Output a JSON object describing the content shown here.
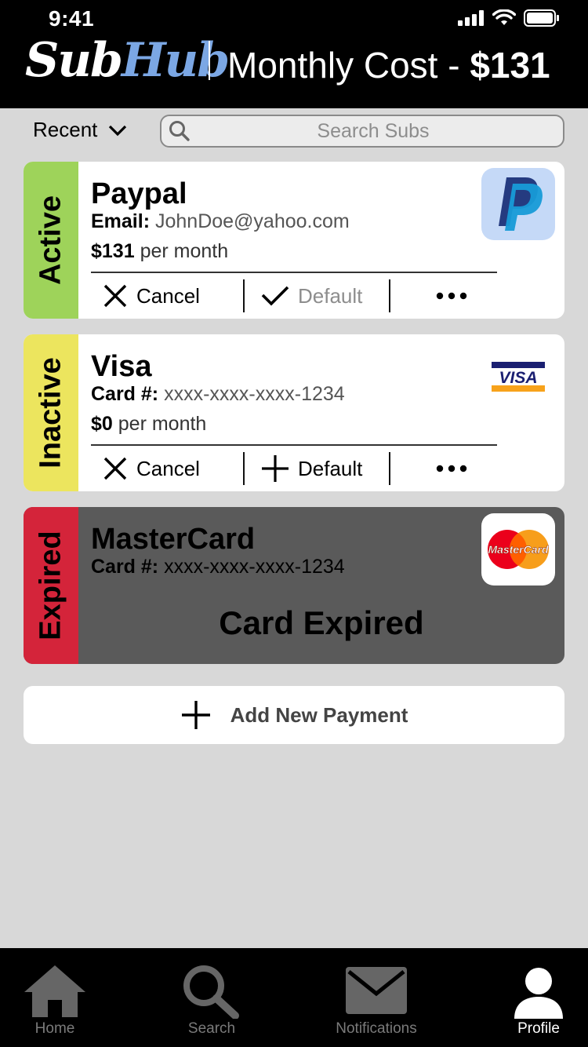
{
  "status": {
    "time": "9:41"
  },
  "header": {
    "logo_sub": "Sub",
    "logo_hub": "Hub",
    "monthly_cost_label": "Monthly Cost - ",
    "monthly_cost_value": "$131"
  },
  "filter": {
    "sort_label": "Recent",
    "search_placeholder": "Search Subs"
  },
  "cards": [
    {
      "status": "Active",
      "status_color": "#9ed35a",
      "name": "Paypal",
      "detail_key": "Email:",
      "detail_value": "JohnDoe@yahoo.com",
      "price": "$131",
      "price_unit": "per month",
      "actions": {
        "cancel": "Cancel",
        "default": "Default"
      },
      "logo_icon": "paypal-logo-icon",
      "logo_bg": "#c5d9f7"
    },
    {
      "status": "Inactive",
      "status_color": "#ece55e",
      "name": "Visa",
      "detail_key": "Card #:",
      "detail_value": "xxxx-xxxx-xxxx-1234",
      "price": "$0",
      "price_unit": "per month",
      "actions": {
        "cancel": "Cancel",
        "default": "Default"
      },
      "logo_icon": "visa-logo-icon",
      "logo_text": "VISA"
    },
    {
      "status": "Expired",
      "status_color": "#d4243a",
      "name": "MasterCard",
      "detail_key": "Card #:",
      "detail_value": "xxxx-xxxx-xxxx-1234",
      "message": "Card Expired",
      "logo_icon": "mastercard-logo-icon",
      "logo_text": "MasterCard"
    }
  ],
  "add_payment_label": "Add New Payment",
  "tabs": [
    {
      "label": "Home",
      "icon": "home-icon"
    },
    {
      "label": "Search",
      "icon": "search-icon"
    },
    {
      "label": "Notifications",
      "icon": "mail-icon"
    },
    {
      "label": "Profile",
      "icon": "profile-icon",
      "active": true
    }
  ]
}
